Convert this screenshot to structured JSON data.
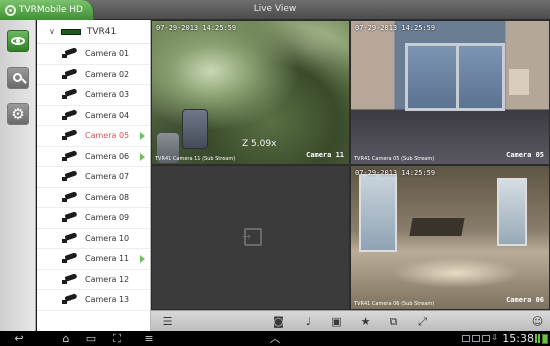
{
  "app": {
    "name": "TVRMobile HD",
    "window_title": "Live View"
  },
  "tree": {
    "root": "TVR41",
    "cameras": [
      {
        "label": "Camera 01",
        "active": false,
        "playing": false
      },
      {
        "label": "Camera 02",
        "active": false,
        "playing": false
      },
      {
        "label": "Camera 03",
        "active": false,
        "playing": false
      },
      {
        "label": "Camera 04",
        "active": false,
        "playing": false
      },
      {
        "label": "Camera 05",
        "active": true,
        "playing": true
      },
      {
        "label": "Camera 06",
        "active": false,
        "playing": true
      },
      {
        "label": "Camera 07",
        "active": false,
        "playing": false
      },
      {
        "label": "Camera 08",
        "active": false,
        "playing": false
      },
      {
        "label": "Camera 09",
        "active": false,
        "playing": false
      },
      {
        "label": "Camera 10",
        "active": false,
        "playing": false
      },
      {
        "label": "Camera 11",
        "active": false,
        "playing": true
      },
      {
        "label": "Camera 12",
        "active": false,
        "playing": false
      },
      {
        "label": "Camera 13",
        "active": false,
        "playing": false
      }
    ]
  },
  "views": [
    {
      "stamp": "07-29-2013 14:25:59",
      "stream": "TVR41 Camera 11 (Sub Stream)",
      "name": "Camera 11",
      "zoom": "Z 5.09x"
    },
    {
      "stamp": "07-29-2013 14:25:59",
      "stream": "TVR41 Camera 05 (Sub Stream)",
      "name": "Camera 05"
    },
    {
      "empty": true
    },
    {
      "stamp": "07-29-2013 14:25:59",
      "stream": "TVR41 Camera 06 (Sub Stream)",
      "name": "Camera 06"
    }
  ],
  "status": {
    "time": "15:38"
  },
  "colors": {
    "brand": "#4e9e41",
    "active_camera": "#d9534f",
    "play": "#6fbf5e"
  }
}
